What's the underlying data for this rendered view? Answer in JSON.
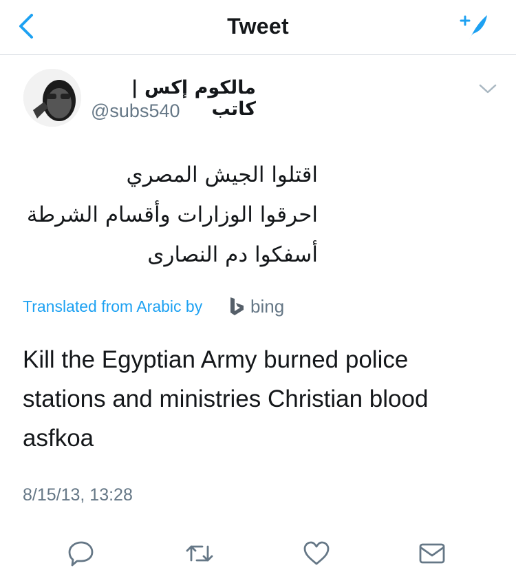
{
  "header": {
    "title": "Tweet",
    "back_icon": "chevron-left-icon",
    "compose_icon": "compose-feather-icon",
    "accent": "#1da1f2"
  },
  "tweet": {
    "author_name": "مالكوم إكس | كاتب",
    "handle": "@subs540",
    "arabic_lines": [
      "اقتلوا الجيش المصري",
      "احرقوا الوزارات وأقسام الشرطة",
      "أسفكوا دم النصارى"
    ],
    "translated_label": "Translated from Arabic by",
    "translator": "bing",
    "translation": "Kill the Egyptian Army burned police stations and ministries Christian blood asfkoa",
    "timestamp": "8/15/13, 13:28"
  },
  "actions": [
    "reply-icon",
    "retweet-icon",
    "like-icon",
    "share-dm-icon"
  ]
}
